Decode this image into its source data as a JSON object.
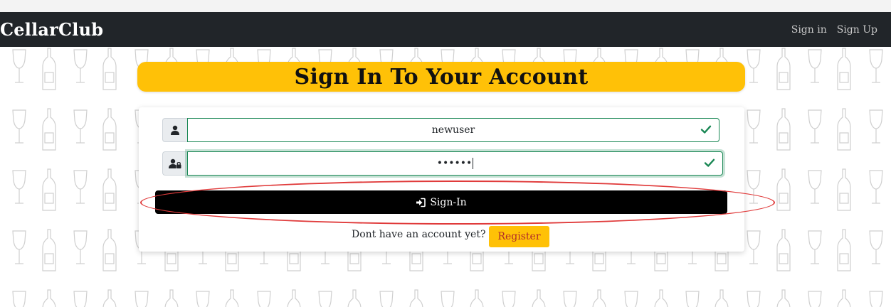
{
  "navbar": {
    "brand": "CellarClub",
    "links": [
      "Sign in",
      "Sign Up"
    ]
  },
  "form": {
    "title": "Sign In To Your Account",
    "username_value": "newuser",
    "password_masked": "••••••",
    "submit_label": "Sign-In",
    "footer_text": "Dont have an account yet?",
    "register_label": "Register"
  },
  "colors": {
    "navbar_bg": "#212529",
    "accent_yellow": "#ffc107",
    "valid_green": "#198754",
    "annotation_red": "#e03b3b"
  },
  "icons": {
    "username_addon": "user-icon",
    "password_addon": "user-lock-icon",
    "valid": "check-icon",
    "submit": "sign-in-icon"
  }
}
